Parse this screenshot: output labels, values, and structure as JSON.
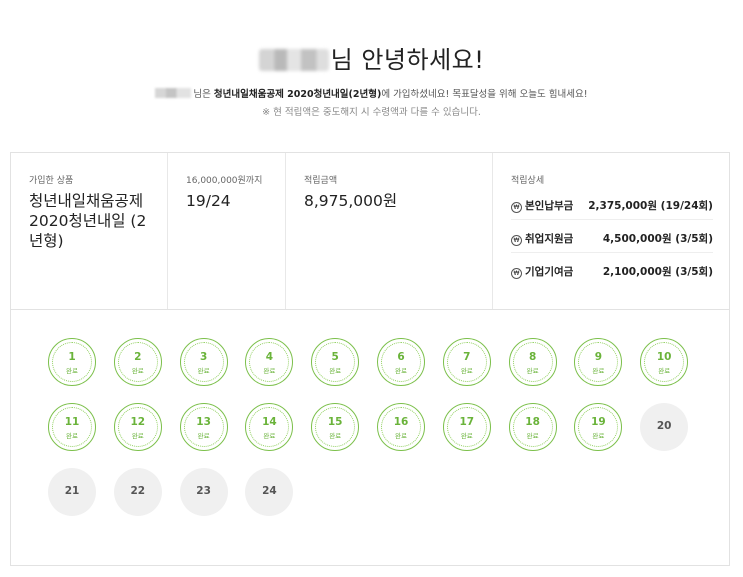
{
  "greeting": {
    "suffix": "님 안녕하세요!"
  },
  "subtitle": {
    "part1": "님은 ",
    "product_bold": "청년내일채움공제 2020청년내일(2년형)",
    "part2": "에 가입하셨네요! 목표달성을 위해 오늘도 힘내세요!",
    "note": "※ 현 적립액은 중도해지 시 수령액과 다를 수 있습니다."
  },
  "summary": {
    "product_label": "가입한 상품",
    "product_value": "청년내일채움공제 2020청년내일 (2년형)",
    "count_label": "16,000,000원까지",
    "count_value": "19/24",
    "amount_label": "적립금액",
    "amount_value": "8,975,000원",
    "detail_label": "적립상세",
    "details": [
      {
        "label": "본인납부금",
        "value": "2,375,000원 (19/24회)"
      },
      {
        "label": "취업지원금",
        "value": "4,500,000원 (3/5회)"
      },
      {
        "label": "기업기여금",
        "value": "2,100,000원 (3/5회)"
      }
    ]
  },
  "payments": {
    "done_label": "완료",
    "items": [
      {
        "n": "1",
        "done": true
      },
      {
        "n": "2",
        "done": true
      },
      {
        "n": "3",
        "done": true
      },
      {
        "n": "4",
        "done": true
      },
      {
        "n": "5",
        "done": true
      },
      {
        "n": "6",
        "done": true
      },
      {
        "n": "7",
        "done": true
      },
      {
        "n": "8",
        "done": true
      },
      {
        "n": "9",
        "done": true
      },
      {
        "n": "10",
        "done": true
      },
      {
        "n": "11",
        "done": true
      },
      {
        "n": "12",
        "done": true
      },
      {
        "n": "13",
        "done": true
      },
      {
        "n": "14",
        "done": true
      },
      {
        "n": "15",
        "done": true
      },
      {
        "n": "16",
        "done": true
      },
      {
        "n": "17",
        "done": true
      },
      {
        "n": "18",
        "done": true
      },
      {
        "n": "19",
        "done": true
      },
      {
        "n": "20",
        "done": false
      },
      {
        "n": "21",
        "done": false
      },
      {
        "n": "22",
        "done": false
      },
      {
        "n": "23",
        "done": false
      },
      {
        "n": "24",
        "done": false
      }
    ]
  },
  "colors": {
    "accent_green": "#7cc04b",
    "pending_gray": "#f0f0f0"
  }
}
